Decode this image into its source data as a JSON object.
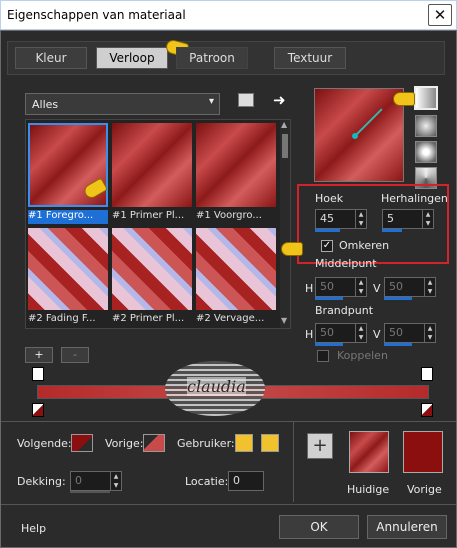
{
  "window": {
    "title": "Eigenschappen van materiaal",
    "close_glyph": "✕"
  },
  "tabs": [
    {
      "label": "Kleur"
    },
    {
      "label": "Verloop"
    },
    {
      "label": "Patroon"
    },
    {
      "label": "Textuur"
    }
  ],
  "gallery": {
    "category": "Alles",
    "items": [
      {
        "label": "#1 Foregro..."
      },
      {
        "label": "#1 Primer Pl..."
      },
      {
        "label": "#1 Voorgro..."
      },
      {
        "label": "#2 Fading F..."
      },
      {
        "label": "#2 Primer Pl..."
      },
      {
        "label": "#2 Vervage..."
      }
    ]
  },
  "angle": {
    "label": "Hoek",
    "value": "45"
  },
  "repeats": {
    "label": "Herhalingen",
    "value": "5"
  },
  "invert": {
    "label": "Omkeren",
    "checked": "✓"
  },
  "center_point": {
    "label": "Middelpunt",
    "h_label": "H",
    "h_value": "50",
    "v_label": "V",
    "v_value": "50"
  },
  "focal_point": {
    "label": "Brandpunt",
    "h_label": "H",
    "h_value": "50",
    "v_label": "V",
    "v_value": "50"
  },
  "link": {
    "label": "Koppelen"
  },
  "editor": {
    "add_label": "+",
    "remove_label": "-",
    "watermark_text": "claudia"
  },
  "bottom": {
    "next_label": "Volgende:",
    "prev_label": "Vorige:",
    "user_label": "Gebruiker:",
    "opacity_label": "Dekking:",
    "opacity_value": "0",
    "location_label": "Locatie:",
    "location_value": "0",
    "add_material_label": "+",
    "current_label": "Huidige",
    "previous_label": "Vorige"
  },
  "footer": {
    "help": "Help",
    "ok": "OK",
    "cancel": "Annuleren"
  },
  "colors": {
    "accent_red": "#8b0f0f",
    "selection_blue": "#1e6fd6",
    "highlight_box": "#d2232a",
    "user_swatch": "#f2c12e"
  }
}
